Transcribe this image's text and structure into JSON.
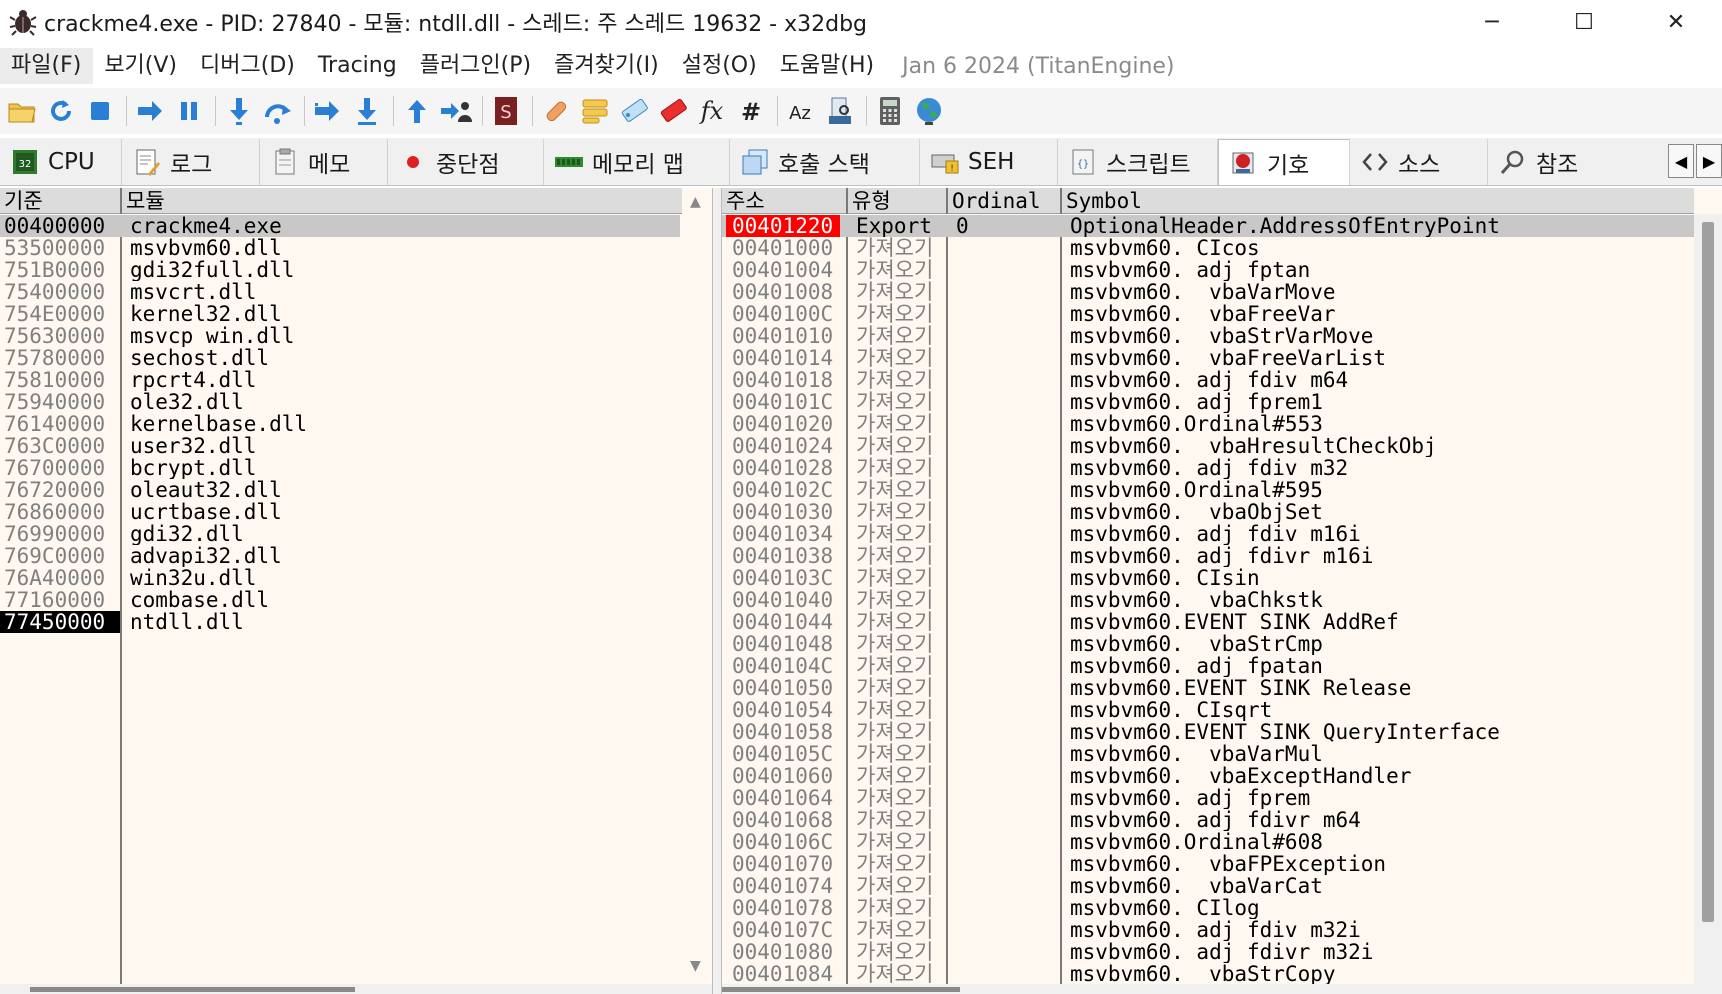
{
  "window": {
    "title": "crackme4.exe - PID: 27840 - 모듈: ntdll.dll - 스레드: 주 스레드 19632 - x32dbg",
    "minimize": "─",
    "maximize": "☐",
    "close": "✕"
  },
  "menu": {
    "items": [
      "파일(F)",
      "보기(V)",
      "디버그(D)",
      "Tracing",
      "플러그인(P)",
      "즐겨찾기(I)",
      "설정(O)",
      "도움말(H)"
    ],
    "date": "Jan 6 2024 (TitanEngine)"
  },
  "toolbar": {
    "buttons": [
      "open-icon",
      "restart-icon",
      "stop-icon",
      "run-icon",
      "pause-icon",
      "step-into-icon",
      "step-over-icon",
      "trace-into-icon",
      "trace-over-icon",
      "execute-till-return-icon",
      "run-to-user-code-icon",
      "scylla-icon",
      "patch-icon",
      "comment-icon",
      "label-icon",
      "bookmark-icon",
      "function-icon",
      "hash-icon",
      "font-icon",
      "memory-search-icon",
      "calculator-icon",
      "globe-icon"
    ]
  },
  "tabs": [
    {
      "label": "CPU",
      "icon": "cpu-icon"
    },
    {
      "label": "로그",
      "icon": "log-icon"
    },
    {
      "label": "메모",
      "icon": "notes-icon"
    },
    {
      "label": "중단점",
      "icon": "breakpoint-icon"
    },
    {
      "label": "메모리 맵",
      "icon": "memory-map-icon"
    },
    {
      "label": "호출 스택",
      "icon": "call-stack-icon"
    },
    {
      "label": "SEH",
      "icon": "seh-icon"
    },
    {
      "label": "스크립트",
      "icon": "script-icon"
    },
    {
      "label": "기호",
      "icon": "symbols-icon"
    },
    {
      "label": "소스",
      "icon": "source-icon"
    },
    {
      "label": "참조",
      "icon": "references-icon"
    }
  ],
  "modules": {
    "headers": {
      "base": "기준",
      "module": "모듈"
    },
    "rows": [
      {
        "base": "00400000",
        "module": "crackme4.exe"
      },
      {
        "base": "53500000",
        "module": "msvbvm60.dll"
      },
      {
        "base": "751B0000",
        "module": "gdi32full.dll"
      },
      {
        "base": "75400000",
        "module": "msvcrt.dll"
      },
      {
        "base": "754E0000",
        "module": "kernel32.dll"
      },
      {
        "base": "75630000",
        "module": "msvcp_win.dll"
      },
      {
        "base": "75780000",
        "module": "sechost.dll"
      },
      {
        "base": "75810000",
        "module": "rpcrt4.dll"
      },
      {
        "base": "75940000",
        "module": "ole32.dll"
      },
      {
        "base": "76140000",
        "module": "kernelbase.dll"
      },
      {
        "base": "763C0000",
        "module": "user32.dll"
      },
      {
        "base": "76700000",
        "module": "bcrypt.dll"
      },
      {
        "base": "76720000",
        "module": "oleaut32.dll"
      },
      {
        "base": "76860000",
        "module": "ucrtbase.dll"
      },
      {
        "base": "76990000",
        "module": "gdi32.dll"
      },
      {
        "base": "769C0000",
        "module": "advapi32.dll"
      },
      {
        "base": "76A40000",
        "module": "win32u.dll"
      },
      {
        "base": "77160000",
        "module": "combase.dll"
      },
      {
        "base": "77450000",
        "module": "ntdll.dll"
      }
    ]
  },
  "symbols": {
    "headers": {
      "address": "주소",
      "type": "유형",
      "ordinal": "Ordinal",
      "symbol": "Symbol"
    },
    "rows": [
      {
        "address": "00401220",
        "type": "Export",
        "ordinal": "0",
        "symbol": "OptionalHeader.AddressOfEntryPoint"
      },
      {
        "address": "00401000",
        "type": "가져오기",
        "ordinal": "",
        "symbol": "msvbvm60._CIcos"
      },
      {
        "address": "00401004",
        "type": "가져오기",
        "ordinal": "",
        "symbol": "msvbvm60._adj_fptan"
      },
      {
        "address": "00401008",
        "type": "가져오기",
        "ordinal": "",
        "symbol": "msvbvm60.__vbaVarMove"
      },
      {
        "address": "0040100C",
        "type": "가져오기",
        "ordinal": "",
        "symbol": "msvbvm60.__vbaFreeVar"
      },
      {
        "address": "00401010",
        "type": "가져오기",
        "ordinal": "",
        "symbol": "msvbvm60.__vbaStrVarMove"
      },
      {
        "address": "00401014",
        "type": "가져오기",
        "ordinal": "",
        "symbol": "msvbvm60.__vbaFreeVarList"
      },
      {
        "address": "00401018",
        "type": "가져오기",
        "ordinal": "",
        "symbol": "msvbvm60._adj_fdiv_m64"
      },
      {
        "address": "0040101C",
        "type": "가져오기",
        "ordinal": "",
        "symbol": "msvbvm60._adj_fprem1"
      },
      {
        "address": "00401020",
        "type": "가져오기",
        "ordinal": "",
        "symbol": "msvbvm60.Ordinal#553"
      },
      {
        "address": "00401024",
        "type": "가져오기",
        "ordinal": "",
        "symbol": "msvbvm60.__vbaHresultCheckObj"
      },
      {
        "address": "00401028",
        "type": "가져오기",
        "ordinal": "",
        "symbol": "msvbvm60._adj_fdiv_m32"
      },
      {
        "address": "0040102C",
        "type": "가져오기",
        "ordinal": "",
        "symbol": "msvbvm60.Ordinal#595"
      },
      {
        "address": "00401030",
        "type": "가져오기",
        "ordinal": "",
        "symbol": "msvbvm60.__vbaObjSet"
      },
      {
        "address": "00401034",
        "type": "가져오기",
        "ordinal": "",
        "symbol": "msvbvm60._adj_fdiv_m16i"
      },
      {
        "address": "00401038",
        "type": "가져오기",
        "ordinal": "",
        "symbol": "msvbvm60._adj_fdivr_m16i"
      },
      {
        "address": "0040103C",
        "type": "가져오기",
        "ordinal": "",
        "symbol": "msvbvm60._CIsin"
      },
      {
        "address": "00401040",
        "type": "가져오기",
        "ordinal": "",
        "symbol": "msvbvm60.__vbaChkstk"
      },
      {
        "address": "00401044",
        "type": "가져오기",
        "ordinal": "",
        "symbol": "msvbvm60.EVENT_SINK_AddRef"
      },
      {
        "address": "00401048",
        "type": "가져오기",
        "ordinal": "",
        "symbol": "msvbvm60.__vbaStrCmp"
      },
      {
        "address": "0040104C",
        "type": "가져오기",
        "ordinal": "",
        "symbol": "msvbvm60._adj_fpatan"
      },
      {
        "address": "00401050",
        "type": "가져오기",
        "ordinal": "",
        "symbol": "msvbvm60.EVENT_SINK_Release"
      },
      {
        "address": "00401054",
        "type": "가져오기",
        "ordinal": "",
        "symbol": "msvbvm60._CIsqrt"
      },
      {
        "address": "00401058",
        "type": "가져오기",
        "ordinal": "",
        "symbol": "msvbvm60.EVENT_SINK_QueryInterface"
      },
      {
        "address": "0040105C",
        "type": "가져오기",
        "ordinal": "",
        "symbol": "msvbvm60.__vbaVarMul"
      },
      {
        "address": "00401060",
        "type": "가져오기",
        "ordinal": "",
        "symbol": "msvbvm60.__vbaExceptHandler"
      },
      {
        "address": "00401064",
        "type": "가져오기",
        "ordinal": "",
        "symbol": "msvbvm60._adj_fprem"
      },
      {
        "address": "00401068",
        "type": "가져오기",
        "ordinal": "",
        "symbol": "msvbvm60._adj_fdivr_m64"
      },
      {
        "address": "0040106C",
        "type": "가져오기",
        "ordinal": "",
        "symbol": "msvbvm60.Ordinal#608"
      },
      {
        "address": "00401070",
        "type": "가져오기",
        "ordinal": "",
        "symbol": "msvbvm60.__vbaFPException"
      },
      {
        "address": "00401074",
        "type": "가져오기",
        "ordinal": "",
        "symbol": "msvbvm60.__vbaVarCat"
      },
      {
        "address": "00401078",
        "type": "가져오기",
        "ordinal": "",
        "symbol": "msvbvm60._CIlog"
      },
      {
        "address": "0040107C",
        "type": "가져오기",
        "ordinal": "",
        "symbol": "msvbvm60._adj_fdiv_m32i"
      },
      {
        "address": "00401080",
        "type": "가져오기",
        "ordinal": "",
        "symbol": "msvbvm60._adj_fdivr_m32i"
      },
      {
        "address": "00401084",
        "type": "가져오기",
        "ordinal": "",
        "symbol": "msvbvm60.__vbaStrCopy"
      }
    ]
  },
  "colors": {
    "pane_background": "#fff8f0",
    "entry_point_highlight": "#ff0000",
    "selected_row": "#c8c8c8",
    "header_background": "#dcdcdc"
  }
}
